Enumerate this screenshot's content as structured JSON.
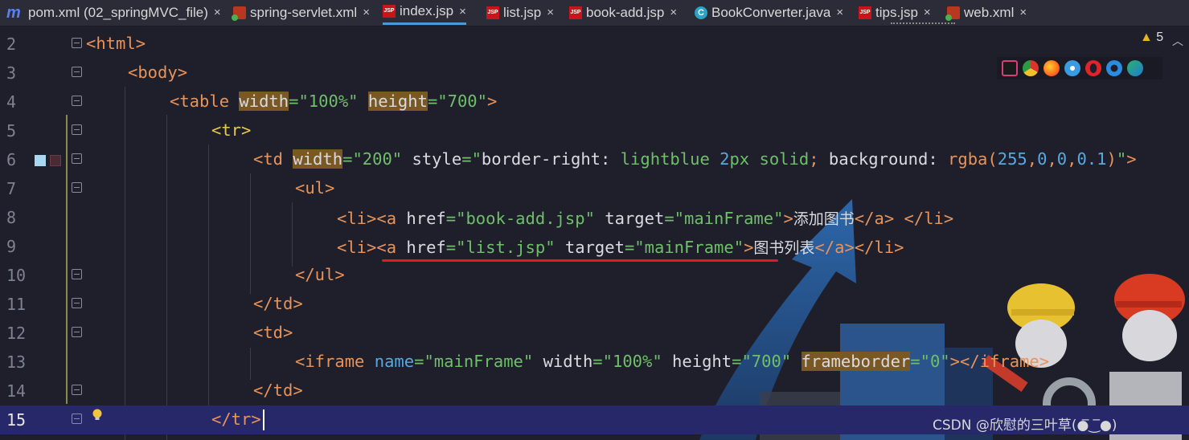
{
  "tabs": [
    {
      "label": "pom.xml (02_springMVC_file)",
      "icon": "maven-icon",
      "active": false
    },
    {
      "label": "spring-servlet.xml",
      "icon": "xml-file-icon",
      "active": false
    },
    {
      "label": "index.jsp",
      "icon": "jsp-file-icon",
      "active": true
    },
    {
      "label": "list.jsp",
      "icon": "jsp-file-icon",
      "active": false
    },
    {
      "label": "book-add.jsp",
      "icon": "jsp-file-icon",
      "active": false
    },
    {
      "label": "BookConverter.java",
      "icon": "java-class-icon",
      "active": false
    },
    {
      "label": "tips.jsp",
      "icon": "jsp-file-icon",
      "active": false
    },
    {
      "label": "web.xml",
      "icon": "xml-file-icon",
      "active": false
    }
  ],
  "tab_close_glyph": "×",
  "jsp_icon_text": "JSP",
  "java_icon_text": "C",
  "maven_icon_text": "m",
  "warnings": {
    "count": "5"
  },
  "line_numbers": [
    "2",
    "3",
    "4",
    "5",
    "6",
    "7",
    "8",
    "9",
    "10",
    "11",
    "12",
    "13",
    "14",
    "15"
  ],
  "code": {
    "l2_tag": "<html>",
    "l3_tag": "<body>",
    "l4_open": "<table ",
    "l4_attr1": "width",
    "l4_eq1": "=",
    "l4_val1": "\"100%\"",
    "l4_attr2": "height",
    "l4_eq2": "=",
    "l4_val2": "\"700\"",
    "l4_close": ">",
    "l5_tag": "<tr>",
    "l6_open": "<td ",
    "l6_attr1": "width",
    "l6_eq1": "=",
    "l6_val1": "\"200\"",
    "l6_style": " style",
    "l6_eq2": "=",
    "l6_q1": "\"",
    "l6_p1": "border-right: ",
    "l6_v1": "lightblue ",
    "l6_n1": "2",
    "l6_v2": "px solid",
    "l6_semi": "; ",
    "l6_p2": "background: ",
    "l6_fn": "rgba(",
    "l6_n2": "255",
    "l6_c1": ",",
    "l6_n3": "0",
    "l6_c2": ",",
    "l6_n4": "0",
    "l6_c3": ",",
    "l6_n5": "0.1",
    "l6_fnc": ")",
    "l6_q2": "\"",
    "l6_close": ">",
    "l7_tag": "<ul>",
    "l8_li": "<li><a ",
    "l8_attr1": "href",
    "l8_eq1": "=",
    "l8_val1": "\"book-add.jsp\"",
    "l8_attr2": " target",
    "l8_eq2": "=",
    "l8_val2": "\"mainFrame\"",
    "l8_gt": ">",
    "l8_text": "添加图书",
    "l8_end": "</a> </li>",
    "l9_li": "<li><a ",
    "l9_attr1": "href",
    "l9_eq1": "=",
    "l9_val1": "\"list.jsp\"",
    "l9_attr2": " target",
    "l9_eq2": "=",
    "l9_val2": "\"mainFrame\"",
    "l9_gt": ">",
    "l9_text": "图书列表",
    "l9_end": "</a></li>",
    "l10_tag": "</ul>",
    "l11_tag": "</td>",
    "l12_tag": "<td>",
    "l13_open": "<iframe ",
    "l13_attr1": "name",
    "l13_eq1": "=",
    "l13_val1": "\"mainFrame\"",
    "l13_attr2": " width",
    "l13_eq2": "=",
    "l13_val2": "\"100%\"",
    "l13_attr3": " height",
    "l13_eq3": "=",
    "l13_val3": "\"700\"",
    "l13_sp": " ",
    "l13_attr4": "frameborder",
    "l13_eq4": "=",
    "l13_val4": "\"0\"",
    "l13_close": "></iframe>",
    "l14_tag": "</td>",
    "l15_tag": "</tr>"
  },
  "browser_icons": [
    "intellij-icon",
    "chrome-icon",
    "firefox-icon",
    "safari-icon",
    "opera-icon",
    "ie-icon",
    "edge-icon"
  ],
  "watermark": "CSDN @欣慰的三叶草(●̅‿̅●)",
  "colors": {
    "tag": "#e8935a",
    "string": "#6fbf6a",
    "number": "#59a8e0",
    "highlight": "#7a5824",
    "current_line": "#26286a",
    "underline": "#e01c1c"
  }
}
